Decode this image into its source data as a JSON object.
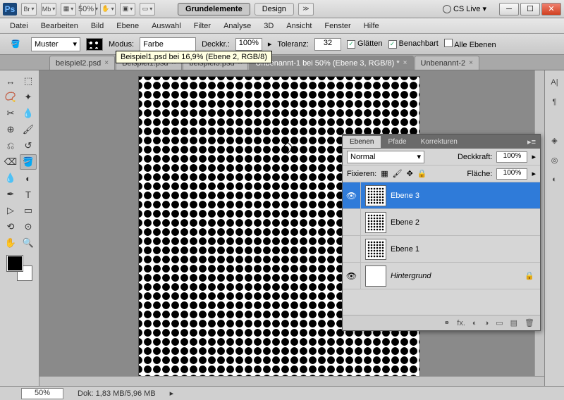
{
  "titlebar": {
    "zoom": "50%",
    "workspace_active": "Grundelemente",
    "workspace_other": "Design",
    "cslive": "CS Live"
  },
  "menu": [
    "Datei",
    "Bearbeiten",
    "Bild",
    "Ebene",
    "Auswahl",
    "Filter",
    "Analyse",
    "3D",
    "Ansicht",
    "Fenster",
    "Hilfe"
  ],
  "options": {
    "pattern_label": "Muster",
    "mode_label": "Modus:",
    "mode_value": "Farbe",
    "opacity_label": "Deckkr.:",
    "opacity_value": "100%",
    "tolerance_label": "Toleranz:",
    "tolerance_value": "32",
    "antialias": "Glätten",
    "contiguous": "Benachbart",
    "all_layers": "Alle Ebenen",
    "tooltip": "Beispiel1.psd bei 16,9% (Ebene 2, RGB/8)"
  },
  "tabs": [
    {
      "label": "beispiel2.psd",
      "active": false
    },
    {
      "label": "Beispiel1.psd",
      "active": false
    },
    {
      "label": "beispiel3.psd",
      "active": false
    },
    {
      "label": "Unbenannt-1 bei 50% (Ebene 3, RGB/8) *",
      "active": true
    },
    {
      "label": "Unbenannt-2",
      "active": false
    }
  ],
  "panel": {
    "tabs": [
      "Ebenen",
      "Pfade",
      "Korrekturen"
    ],
    "blend_mode": "Normal",
    "opacity_label": "Deckkraft:",
    "opacity": "100%",
    "lock_label": "Fixieren:",
    "fill_label": "Fläche:",
    "fill": "100%",
    "layers": [
      {
        "name": "Ebene 3",
        "visible": true,
        "selected": true,
        "thumb": "dots"
      },
      {
        "name": "Ebene 2",
        "visible": false,
        "selected": false,
        "thumb": "dots"
      },
      {
        "name": "Ebene 1",
        "visible": false,
        "selected": false,
        "thumb": "dots"
      },
      {
        "name": "Hintergrund",
        "visible": true,
        "selected": false,
        "thumb": "white",
        "locked": true,
        "bg": true
      }
    ]
  },
  "status": {
    "zoom": "50%",
    "doc": "Dok: 1,83 MB/5,96 MB"
  }
}
